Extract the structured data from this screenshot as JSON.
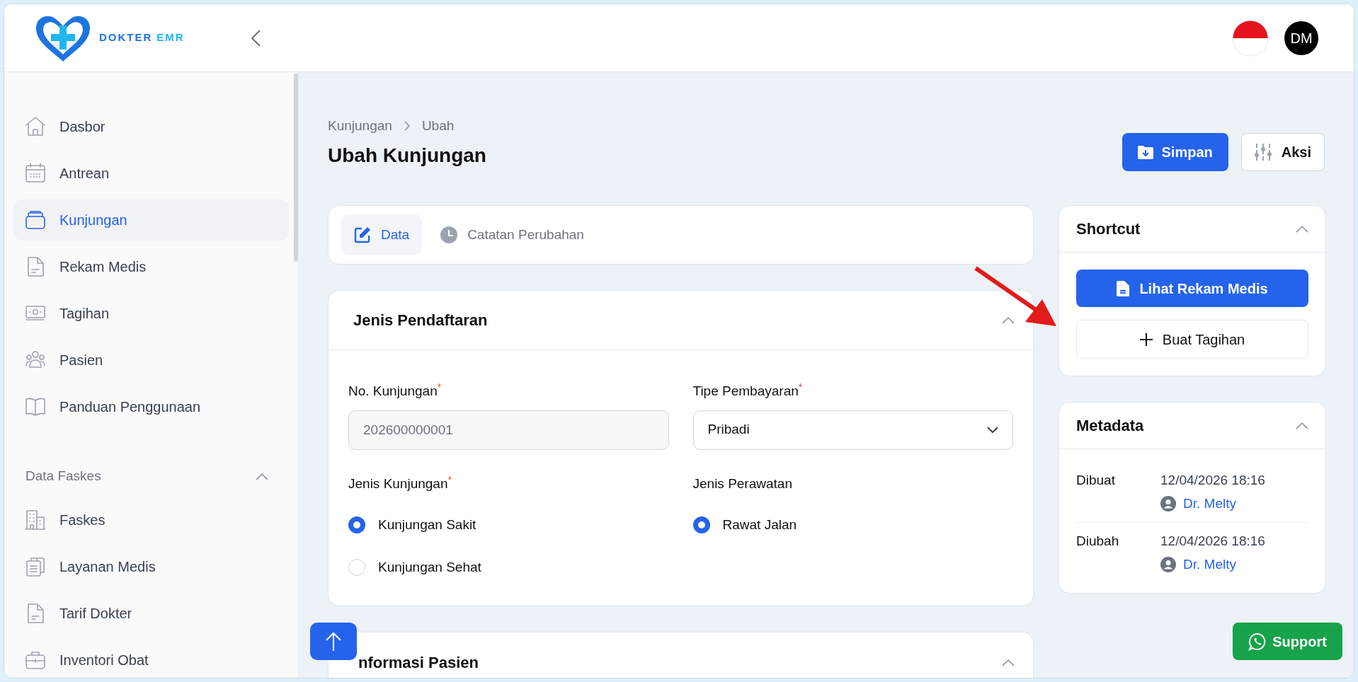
{
  "brand": [
    "DOKTER",
    "EMR"
  ],
  "header": {
    "avatar": "DM"
  },
  "sidebar": {
    "sections": [
      {
        "items": [
          {
            "label": "Dasbor",
            "kind": "home",
            "selected": false
          },
          {
            "label": "Antrean",
            "kind": "calendar",
            "selected": false
          },
          {
            "label": "Kunjungan",
            "kind": "tray",
            "selected": true
          },
          {
            "label": "Rekam Medis",
            "kind": "document",
            "selected": false
          },
          {
            "label": "Tagihan",
            "kind": "money",
            "selected": false
          },
          {
            "label": "Pasien",
            "kind": "people",
            "selected": false
          },
          {
            "label": "Panduan Penggunaan",
            "kind": "book",
            "selected": false
          }
        ]
      },
      {
        "title": "Data Faskes",
        "expanded": true,
        "items": [
          {
            "label": "Faskes",
            "kind": "building",
            "selected": false
          },
          {
            "label": "Layanan Medis",
            "kind": "clipboard",
            "selected": false
          },
          {
            "label": "Tarif Dokter",
            "kind": "document",
            "selected": false
          },
          {
            "label": "Inventori Obat",
            "kind": "briefcase",
            "selected": false
          }
        ]
      }
    ]
  },
  "breadcrumb": [
    "Kunjungan",
    "Ubah"
  ],
  "page_title": "Ubah Kunjungan",
  "actions": [
    {
      "label": "Simpan",
      "kind": "primary"
    },
    {
      "label": "Aksi",
      "kind": "secondary"
    }
  ],
  "tabs": [
    {
      "label": "Data",
      "kind": "edit",
      "selected": true
    },
    {
      "label": "Catatan Perubahan",
      "kind": "clock",
      "selected": false
    }
  ],
  "registration": {
    "title": "Jenis Pendaftaran",
    "expanded": true,
    "fields": [
      {
        "label": "No. Kunjungan",
        "required_mark": "*",
        "kind": "text",
        "value": "202600000001",
        "disabled": true
      },
      {
        "label": "Tipe Pembayaran",
        "required_mark": "*",
        "kind": "select",
        "value": "Pribadi",
        "disabled": false
      },
      {
        "label": "Jenis Kunjungan",
        "required_mark": "*",
        "kind": "radio",
        "options": [
          {
            "label": "Kunjungan Sakit",
            "selected": true
          },
          {
            "label": "Kunjungan Sehat",
            "selected": false
          }
        ]
      },
      {
        "label": "Jenis Perawatan",
        "kind": "radio",
        "options": [
          {
            "label": "Rawat Jalan",
            "selected": true
          }
        ]
      }
    ]
  },
  "patient_section": {
    "title": "nformasi Pasien",
    "expanded": true
  },
  "shortcut": {
    "title": "Shortcut",
    "expanded": true,
    "buttons": [
      {
        "label": "Lihat Rekam Medis",
        "kind": "primary"
      },
      {
        "label": "Buat Tagihan",
        "kind": "secondary"
      }
    ]
  },
  "metadata": {
    "title": "Metadata",
    "expanded": true,
    "rows": [
      {
        "label": "Dibuat",
        "time": "12/04/2026 18:16",
        "user": "Dr. Melty"
      },
      {
        "label": "Diubah",
        "time": "12/04/2026 18:16",
        "user": "Dr. Melty"
      }
    ]
  },
  "support": {
    "label": "Support"
  }
}
